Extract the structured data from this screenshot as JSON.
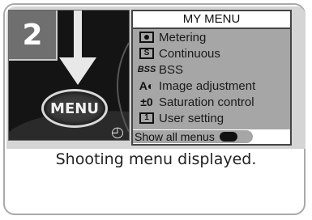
{
  "step_number": "2",
  "camera": {
    "menu_button_label": "MENU",
    "timer_icon": "self-timer-icon"
  },
  "lcd": {
    "title": "MY MENU",
    "items": [
      {
        "icon": "metering-icon",
        "label": "Metering"
      },
      {
        "icon": "continuous-icon",
        "icon_text": "S",
        "label": "Continuous"
      },
      {
        "icon": "bss-icon",
        "icon_text": "BSS",
        "label": "BSS"
      },
      {
        "icon": "image-adjustment-icon",
        "icon_text": "A◐",
        "label": "Image adjustment"
      },
      {
        "icon": "saturation-icon",
        "icon_text": "±0",
        "label": "Saturation control"
      },
      {
        "icon": "user-setting-icon",
        "icon_text": "1",
        "label": "User setting"
      }
    ],
    "footer": "Show all menus",
    "footer_icon": "enter-icon"
  },
  "caption": "Shooting menu displayed.",
  "colors": {
    "band": "#d5d5d5",
    "list_bg": "#a6a6a6",
    "border": "#a9a9a9"
  }
}
